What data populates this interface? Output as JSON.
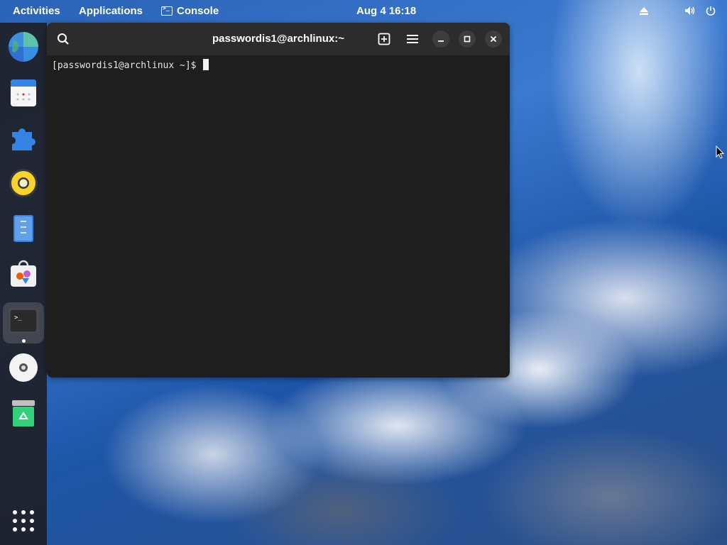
{
  "topbar": {
    "activities": "Activities",
    "applications": "Applications",
    "active_app": "Console",
    "clock": "Aug 4  16:18",
    "tray_icons": [
      "eject-icon",
      "volume-icon",
      "power-icon"
    ]
  },
  "dock": {
    "items": [
      {
        "name": "web-browser-icon"
      },
      {
        "name": "calendar-icon"
      },
      {
        "name": "extensions-icon"
      },
      {
        "name": "rhythmbox-icon"
      },
      {
        "name": "text-editor-icon"
      },
      {
        "name": "software-icon"
      },
      {
        "name": "console-icon",
        "active": true
      },
      {
        "name": "disc-icon"
      },
      {
        "name": "trash-icon"
      }
    ],
    "show_apps": "app-grid-icon"
  },
  "window": {
    "title": "passwordis1@archlinux:~",
    "buttons": [
      "search-icon",
      "new-tab-icon",
      "menu-icon",
      "minimize-icon",
      "maximize-icon",
      "close-icon"
    ],
    "prompt": "[passwordis1@archlinux ~]$ "
  },
  "colors": {
    "terminal_bg": "#1e1e1e",
    "headerbar_bg": "#2c2c2c",
    "dock_bg": "#1e2026"
  }
}
